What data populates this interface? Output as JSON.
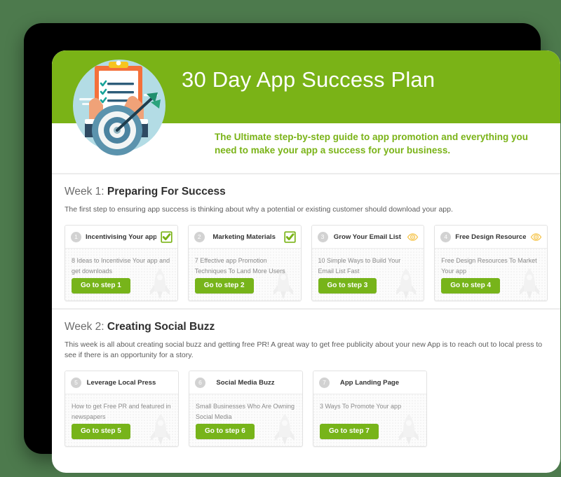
{
  "header": {
    "title": "30 Day App Success Plan",
    "subtitle": "The Ultimate step-by-step guide to app promotion and everything you need to make your app a success for your business.",
    "illustration": "clipboard-target-illustration",
    "green": "#7ab317"
  },
  "sections": [
    {
      "week_label": "Week 1:",
      "week_title": "Preparing For Success",
      "description": "The first step to ensuring app success is thinking about why a potential or existing customer should download your app.",
      "cards": [
        {
          "number": "1",
          "title": "Incentivising Your app",
          "description": "8 Ideas to Incentivise Your app and get downloads",
          "button": "Go to step 1",
          "status_icon": "checkbox-checked-icon"
        },
        {
          "number": "2",
          "title": "Marketing Materials",
          "description": "7 Effective app Promotion Techniques To Land More Users",
          "button": "Go to step 2",
          "status_icon": "checkbox-checked-icon"
        },
        {
          "number": "3",
          "title": "Grow Your Email List",
          "description": "10 Simple Ways to Build Your Email List Fast",
          "button": "Go to step 3",
          "status_icon": "eye-icon"
        },
        {
          "number": "4",
          "title": "Free Design Resources",
          "description": "Free Design Resources To Market Your app",
          "button": "Go to step 4",
          "status_icon": "eye-icon"
        }
      ]
    },
    {
      "week_label": "Week 2:",
      "week_title": "Creating Social Buzz",
      "description": "This week is all about creating social buzz and getting free PR! A great way to get free publicity about your new App is to reach out to local press to see if there is an opportunity for a story.",
      "cards": [
        {
          "number": "5",
          "title": "Leverage Local Press",
          "description": "How to get Free PR and featured in newspapers",
          "button": "Go to step 5",
          "status_icon": "none"
        },
        {
          "number": "6",
          "title": "Social Media Buzz",
          "description": "Small Businesses Who Are Owning Social Media",
          "button": "Go to step 6",
          "status_icon": "none"
        },
        {
          "number": "7",
          "title": "App Landing Page",
          "description": "3 Ways To Promote Your app",
          "button": "Go to step 7",
          "status_icon": "none"
        }
      ]
    }
  ],
  "colors": {
    "header_green": "#7ab317",
    "button_green": "#77b41a",
    "check_green": "#7ab317",
    "eye_amber": "#f6c95a",
    "badge_grey": "#d2d2d2",
    "page_background": "#4d7a4d"
  }
}
